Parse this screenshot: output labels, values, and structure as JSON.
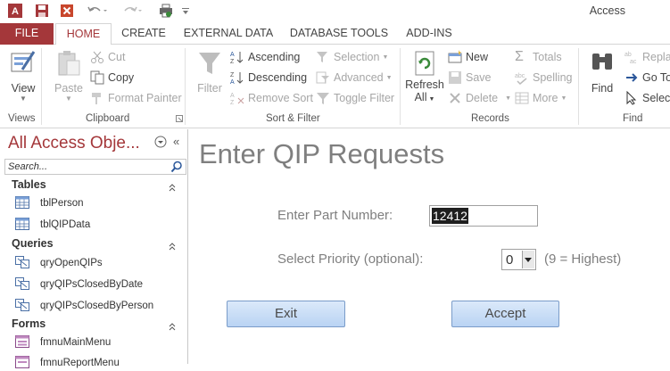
{
  "window": {
    "title": "Access"
  },
  "tabs": [
    "FILE",
    "HOME",
    "CREATE",
    "EXTERNAL DATA",
    "DATABASE TOOLS",
    "ADD-INS"
  ],
  "ribbon": {
    "views": {
      "group": "Views",
      "view": "View"
    },
    "clipboard": {
      "group": "Clipboard",
      "paste": "Paste",
      "cut": "Cut",
      "copy": "Copy",
      "format_painter": "Format Painter"
    },
    "sort_filter": {
      "group": "Sort & Filter",
      "filter": "Filter",
      "ascending": "Ascending",
      "descending": "Descending",
      "remove_sort": "Remove Sort",
      "selection": "Selection",
      "advanced": "Advanced",
      "toggle_filter": "Toggle Filter"
    },
    "records": {
      "group": "Records",
      "refresh": "Refresh",
      "refresh_all": "All",
      "new": "New",
      "save": "Save",
      "delete": "Delete",
      "totals": "Totals",
      "spelling": "Spelling",
      "more": "More"
    },
    "find": {
      "group": "Find",
      "find": "Find",
      "replace": "Replac",
      "goto": "Go To",
      "select": "Select"
    }
  },
  "nav": {
    "title": "All Access Obje...",
    "search_placeholder": "Search...",
    "sections": [
      {
        "label": "Tables",
        "items": [
          "tblPerson",
          "tblQIPData"
        ]
      },
      {
        "label": "Queries",
        "items": [
          "qryOpenQIPs",
          "qryQIPsClosedByDate",
          "qryQIPsClosedByPerson"
        ]
      },
      {
        "label": "Forms",
        "items": [
          "fmnuMainMenu",
          "fmnuReportMenu"
        ]
      }
    ]
  },
  "form": {
    "title": "Enter QIP Requests",
    "part_label": "Enter Part Number:",
    "part_value": "12412",
    "priority_label": "Select Priority (optional):",
    "priority_value": "0",
    "priority_hint": "(9 = Highest)",
    "exit_label": "Exit",
    "accept_label": "Accept"
  },
  "colors": {
    "accent": "#a4373a",
    "button_fill": "#c6dbf6",
    "button_border": "#7a9cc9"
  }
}
